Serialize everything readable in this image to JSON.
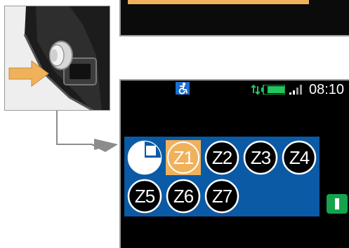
{
  "colors": {
    "screen_bg": "#000000",
    "zone_panel": "#0b5aa6",
    "selected_zone": "#f0b15b",
    "battery_green": "#22c55e",
    "action_green": "#15a34b",
    "connector_gray": "#8c8c8c"
  },
  "status_bar": {
    "time": "08:10",
    "icons": [
      "accessibility-icon",
      "data-arrows-icon",
      "battery-icon",
      "signal-icon"
    ]
  },
  "mode_button": {
    "icon": "stop-mode-icon"
  },
  "zones": [
    {
      "label": "Z1",
      "selected": true
    },
    {
      "label": "Z2",
      "selected": false
    },
    {
      "label": "Z3",
      "selected": false
    },
    {
      "label": "Z4",
      "selected": false
    },
    {
      "label": "Z5",
      "selected": false
    },
    {
      "label": "Z6",
      "selected": false
    },
    {
      "label": "Z7",
      "selected": false
    }
  ],
  "side_button": {
    "icon": "pause-bar-icon"
  }
}
